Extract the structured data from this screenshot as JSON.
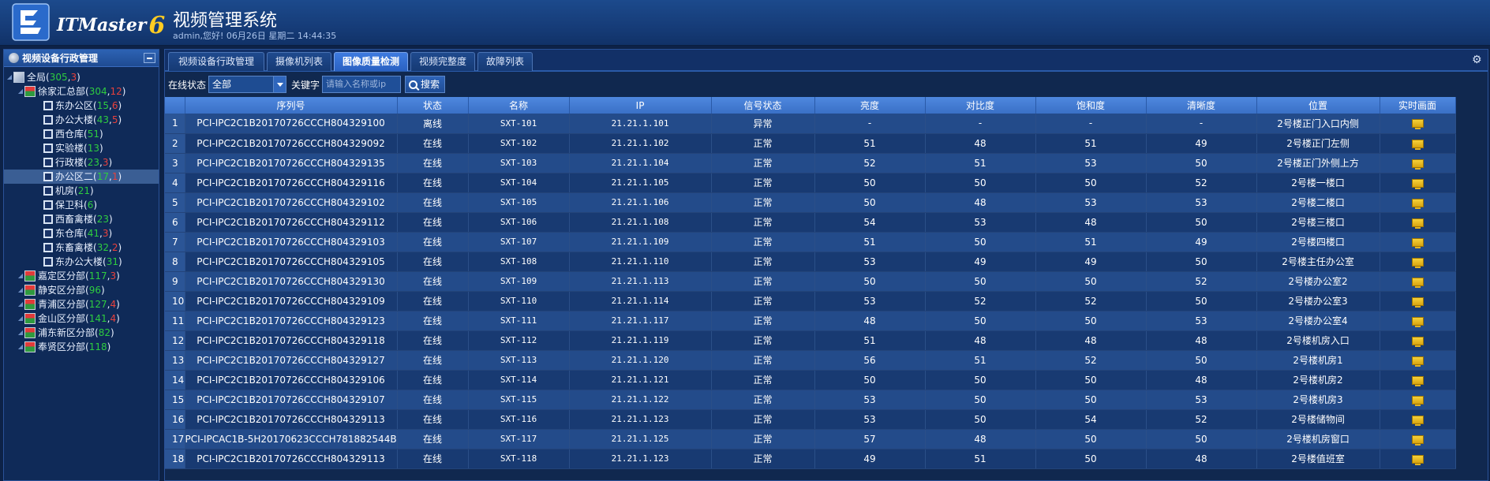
{
  "header": {
    "logo_text": "ITMaster",
    "logo_num": "6",
    "title": "视频管理系统",
    "greeting": "admin,您好! 06月26日 星期二 14:44:35"
  },
  "left": {
    "title": "视频设备行政管理",
    "tree": [
      {
        "label": "全局",
        "g": "305",
        "r": "3",
        "level": 0,
        "type": "root"
      },
      {
        "label": "徐家汇总部",
        "g": "304",
        "r": "12",
        "level": 1,
        "type": "branch"
      },
      {
        "label": "东办公区",
        "g": "15",
        "r": "6",
        "level": 2,
        "type": "node"
      },
      {
        "label": "办公大楼",
        "g": "43",
        "r": "5",
        "level": 2,
        "type": "node"
      },
      {
        "label": "西仓库",
        "g": "51",
        "r": "",
        "level": 2,
        "type": "node"
      },
      {
        "label": "实验楼",
        "g": "13",
        "r": "",
        "level": 2,
        "type": "node"
      },
      {
        "label": "行政楼",
        "g": "23",
        "r": "3",
        "level": 2,
        "type": "node"
      },
      {
        "label": "办公区二",
        "g": "17",
        "r": "1",
        "level": 2,
        "type": "node",
        "selected": true
      },
      {
        "label": "机房",
        "g": "21",
        "r": "",
        "level": 2,
        "type": "node"
      },
      {
        "label": "保卫科",
        "g": "6",
        "r": "",
        "level": 2,
        "type": "node"
      },
      {
        "label": "西畜禽楼",
        "g": "23",
        "r": "",
        "level": 2,
        "type": "node"
      },
      {
        "label": "东仓库",
        "g": "41",
        "r": "3",
        "level": 2,
        "type": "node"
      },
      {
        "label": "东畜禽楼",
        "g": "32",
        "r": "2",
        "level": 2,
        "type": "node"
      },
      {
        "label": "东办公大楼",
        "g": "31",
        "r": "",
        "level": 2,
        "type": "node"
      },
      {
        "label": "嘉定区分部",
        "g": "117",
        "r": "3",
        "level": 1,
        "type": "branch"
      },
      {
        "label": "静安区分部",
        "g": "96",
        "r": "",
        "level": 1,
        "type": "branch"
      },
      {
        "label": "青浦区分部",
        "g": "127",
        "r": "4",
        "level": 1,
        "type": "branch"
      },
      {
        "label": "金山区分部",
        "g": "141",
        "r": "4",
        "level": 1,
        "type": "branch"
      },
      {
        "label": "浦东新区分部",
        "g": "82",
        "r": "",
        "level": 1,
        "type": "branch"
      },
      {
        "label": "奉贤区分部",
        "g": "118",
        "r": "",
        "level": 1,
        "type": "branch"
      }
    ]
  },
  "tabs": [
    {
      "label": "视频设备行政管理",
      "active": false
    },
    {
      "label": "摄像机列表",
      "active": false
    },
    {
      "label": "图像质量检测",
      "active": true
    },
    {
      "label": "视频完整度",
      "active": false
    },
    {
      "label": "故障列表",
      "active": false
    }
  ],
  "toolbar": {
    "status_label": "在线状态",
    "status_value": "全部",
    "keyword_label": "关键字",
    "keyword_placeholder": "请输入名称或ip",
    "search_label": "搜索"
  },
  "table": {
    "columns": [
      "",
      "序列号",
      "状态",
      "名称",
      "IP",
      "信号状态",
      "亮度",
      "对比度",
      "饱和度",
      "清晰度",
      "位置",
      "实时画面"
    ],
    "rows": [
      [
        "1",
        "PCI-IPC2C1B20170726CCCH804329100",
        "离线",
        "SXT-101",
        "21.21.1.101",
        "异常",
        "-",
        "-",
        "-",
        "-",
        "2号楼正门入口内侧"
      ],
      [
        "2",
        "PCI-IPC2C1B20170726CCCH804329092",
        "在线",
        "SXT-102",
        "21.21.1.102",
        "正常",
        "51",
        "48",
        "51",
        "49",
        "2号楼正门左侧"
      ],
      [
        "3",
        "PCI-IPC2C1B20170726CCCH804329135",
        "在线",
        "SXT-103",
        "21.21.1.104",
        "正常",
        "52",
        "51",
        "53",
        "50",
        "2号楼正门外侧上方"
      ],
      [
        "4",
        "PCI-IPC2C1B20170726CCCH804329116",
        "在线",
        "SXT-104",
        "21.21.1.105",
        "正常",
        "50",
        "50",
        "50",
        "52",
        "2号楼一楼口"
      ],
      [
        "5",
        "PCI-IPC2C1B20170726CCCH804329102",
        "在线",
        "SXT-105",
        "21.21.1.106",
        "正常",
        "50",
        "48",
        "53",
        "53",
        "2号楼二楼口"
      ],
      [
        "6",
        "PCI-IPC2C1B20170726CCCH804329112",
        "在线",
        "SXT-106",
        "21.21.1.108",
        "正常",
        "54",
        "53",
        "48",
        "50",
        "2号楼三楼口"
      ],
      [
        "7",
        "PCI-IPC2C1B20170726CCCH804329103",
        "在线",
        "SXT-107",
        "21.21.1.109",
        "正常",
        "51",
        "50",
        "51",
        "49",
        "2号楼四楼口"
      ],
      [
        "8",
        "PCI-IPC2C1B20170726CCCH804329105",
        "在线",
        "SXT-108",
        "21.21.1.110",
        "正常",
        "53",
        "49",
        "49",
        "50",
        "2号楼主任办公室"
      ],
      [
        "9",
        "PCI-IPC2C1B20170726CCCH804329130",
        "在线",
        "SXT-109",
        "21.21.1.113",
        "正常",
        "50",
        "50",
        "50",
        "52",
        "2号楼办公室2"
      ],
      [
        "10",
        "PCI-IPC2C1B20170726CCCH804329109",
        "在线",
        "SXT-110",
        "21.21.1.114",
        "正常",
        "53",
        "52",
        "52",
        "50",
        "2号楼办公室3"
      ],
      [
        "11",
        "PCI-IPC2C1B20170726CCCH804329123",
        "在线",
        "SXT-111",
        "21.21.1.117",
        "正常",
        "48",
        "50",
        "50",
        "53",
        "2号楼办公室4"
      ],
      [
        "12",
        "PCI-IPC2C1B20170726CCCH804329118",
        "在线",
        "SXT-112",
        "21.21.1.119",
        "正常",
        "51",
        "48",
        "48",
        "48",
        "2号楼机房入口"
      ],
      [
        "13",
        "PCI-IPC2C1B20170726CCCH804329127",
        "在线",
        "SXT-113",
        "21.21.1.120",
        "正常",
        "56",
        "51",
        "52",
        "50",
        "2号楼机房1"
      ],
      [
        "14",
        "PCI-IPC2C1B20170726CCCH804329106",
        "在线",
        "SXT-114",
        "21.21.1.121",
        "正常",
        "50",
        "50",
        "50",
        "48",
        "2号楼机房2"
      ],
      [
        "15",
        "PCI-IPC2C1B20170726CCCH804329107",
        "在线",
        "SXT-115",
        "21.21.1.122",
        "正常",
        "53",
        "50",
        "50",
        "53",
        "2号楼机房3"
      ],
      [
        "16",
        "PCI-IPC2C1B20170726CCCH804329113",
        "在线",
        "SXT-116",
        "21.21.1.123",
        "正常",
        "53",
        "50",
        "54",
        "52",
        "2号楼储物间"
      ],
      [
        "17",
        "PCI-IPCAC1B-5H20170623CCCH781882544B",
        "在线",
        "SXT-117",
        "21.21.1.125",
        "正常",
        "57",
        "48",
        "50",
        "50",
        "2号楼机房窗口"
      ],
      [
        "18",
        "PCI-IPC2C1B20170726CCCH804329113",
        "在线",
        "SXT-118",
        "21.21.1.123",
        "正常",
        "49",
        "51",
        "50",
        "48",
        "2号楼值班室"
      ]
    ]
  },
  "colors": {
    "online": "#2ed03a",
    "offline": "#ff3b3b",
    "accent": "#3e7be0"
  }
}
